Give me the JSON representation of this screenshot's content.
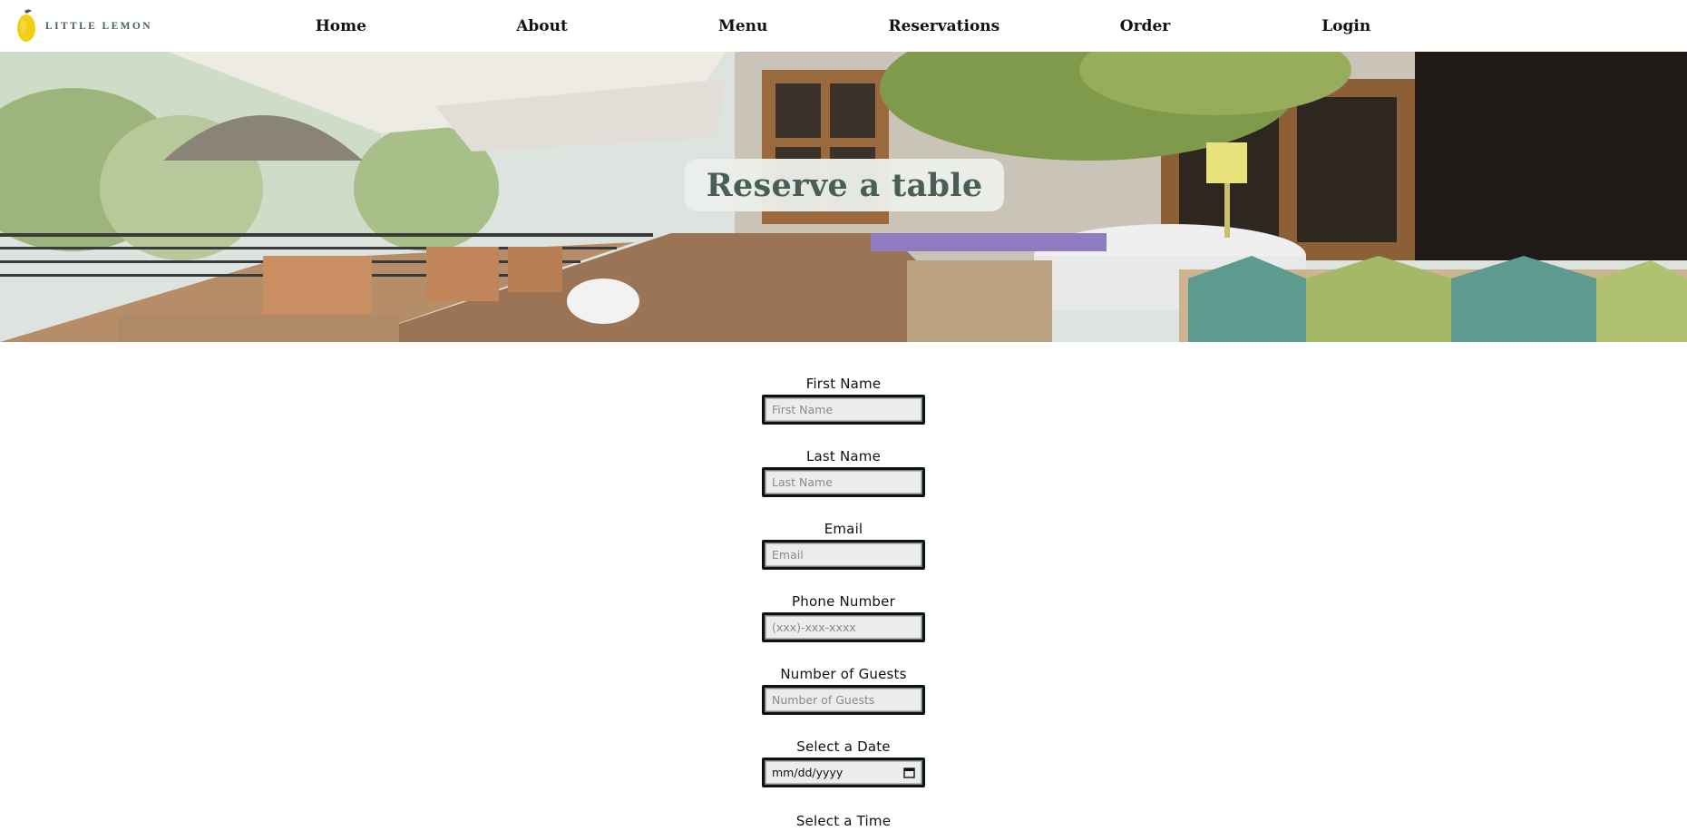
{
  "brand": {
    "name": "LITTLE LEMON",
    "color": "#495e57",
    "accent": "#f4ce14"
  },
  "nav": {
    "items": [
      "Home",
      "About",
      "Menu",
      "Reservations",
      "Order",
      "Login"
    ]
  },
  "hero": {
    "title": "Reserve a table"
  },
  "form": {
    "first_name": {
      "label": "First Name",
      "placeholder": "First Name"
    },
    "last_name": {
      "label": "Last Name",
      "placeholder": "Last Name"
    },
    "email": {
      "label": "Email",
      "placeholder": "Email"
    },
    "phone": {
      "label": "Phone Number",
      "placeholder": "(xxx)-xxx-xxxx"
    },
    "guests": {
      "label": "Number of Guests",
      "placeholder": "Number of Guests"
    },
    "date": {
      "label": "Select a Date",
      "value": "mm/dd/yyyy",
      "icon": "calendar-icon"
    },
    "time": {
      "label": "Select a Time"
    }
  }
}
